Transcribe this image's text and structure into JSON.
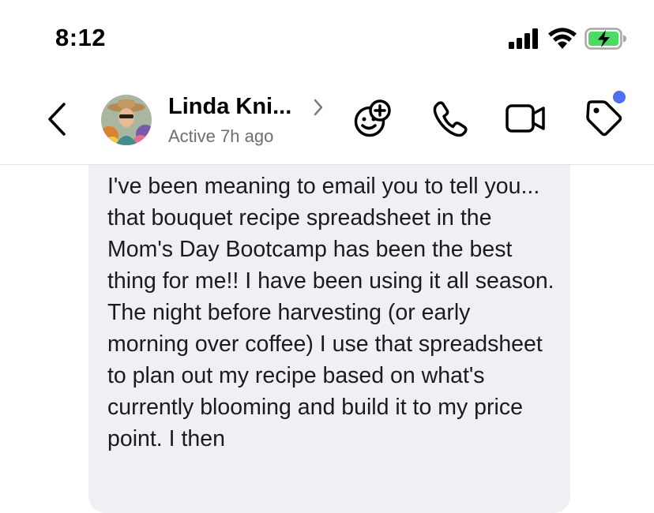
{
  "status_bar": {
    "time": "8:12",
    "icons": [
      "cellular-signal-icon",
      "wifi-icon",
      "battery-charging-icon"
    ],
    "battery_color": "#4cd964"
  },
  "header": {
    "contact_name": "Linda Kni...",
    "contact_status": "Active 7h ago",
    "actions": [
      "back-chevron-icon",
      "add-reaction-icon",
      "phone-icon",
      "video-camera-icon",
      "tag-icon"
    ],
    "notification_dot_color": "#4f6ff0"
  },
  "message": {
    "text": "I've been meaning to email you to tell you... that bouquet recipe spreadsheet in the Mom's Day Bootcamp has been the best thing for me!! I have been using it all season. The night before harvesting (or early morning over coffee) I use that spreadsheet to plan out my recipe based on what's currently blooming and build it to my price point. I then"
  }
}
